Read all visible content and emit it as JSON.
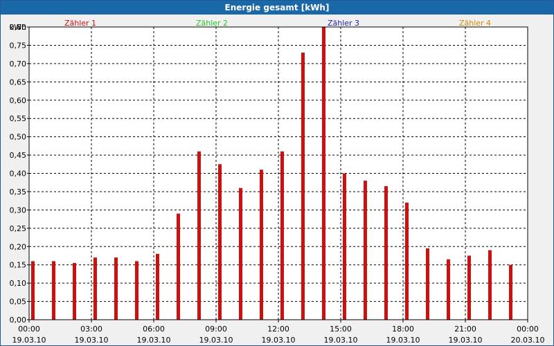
{
  "window": {
    "title": "Energie gesamt [kWh]"
  },
  "legend": [
    {
      "name": "Zähler 1",
      "color": "#cc1111"
    },
    {
      "name": "Zähler 2",
      "color": "#22cc22"
    },
    {
      "name": "Zähler 3",
      "color": "#2222aa"
    },
    {
      "name": "Zähler 4",
      "color": "#d08a00"
    }
  ],
  "chart_data": {
    "type": "bar",
    "title": "Energie gesamt [kWh]",
    "ylabel": "kWh",
    "xlabel": "",
    "ylim": [
      0,
      0.8
    ],
    "yticks": [
      "0,00",
      "0,05",
      "0,10",
      "0,15",
      "0,20",
      "0,25",
      "0,30",
      "0,35",
      "0,40",
      "0,45",
      "0,50",
      "0,55",
      "0,60",
      "0,65",
      "0,70",
      "0,75",
      "0,80"
    ],
    "xlim": [
      "19.03.10 00:00",
      "20.03.10 00:00"
    ],
    "xticks": [
      {
        "time": "00:00",
        "date": "19.03.10"
      },
      {
        "time": "03:00",
        "date": "19.03.10"
      },
      {
        "time": "06:00",
        "date": "19.03.10"
      },
      {
        "time": "09:00",
        "date": "19.03.10"
      },
      {
        "time": "12:00",
        "date": "19.03.10"
      },
      {
        "time": "15:00",
        "date": "19.03.10"
      },
      {
        "time": "18:00",
        "date": "19.03.10"
      },
      {
        "time": "21:00",
        "date": "19.03.10"
      },
      {
        "time": "00:00",
        "date": "20.03.10"
      }
    ],
    "grid": true,
    "legend_position": "top",
    "categories": [
      "00:00",
      "01:00",
      "02:00",
      "03:00",
      "04:00",
      "05:00",
      "06:00",
      "07:00",
      "08:00",
      "09:00",
      "10:00",
      "11:00",
      "12:00",
      "13:00",
      "14:00",
      "15:00",
      "16:00",
      "17:00",
      "18:00",
      "19:00",
      "20:00",
      "21:00",
      "22:00",
      "23:00"
    ],
    "series": [
      {
        "name": "Zähler 1",
        "color": "#cc1111",
        "values": [
          0.16,
          0.16,
          0.155,
          0.17,
          0.17,
          0.16,
          0.18,
          0.29,
          0.46,
          0.425,
          0.36,
          0.41,
          0.46,
          0.73,
          0.8,
          0.4,
          0.38,
          0.365,
          0.32,
          0.195,
          0.165,
          0.175,
          0.19,
          0.15
        ]
      },
      {
        "name": "Zähler 2",
        "color": "#22cc22",
        "values": []
      },
      {
        "name": "Zähler 3",
        "color": "#2222aa",
        "values": []
      },
      {
        "name": "Zähler 4",
        "color": "#d08a00",
        "values": []
      }
    ]
  }
}
